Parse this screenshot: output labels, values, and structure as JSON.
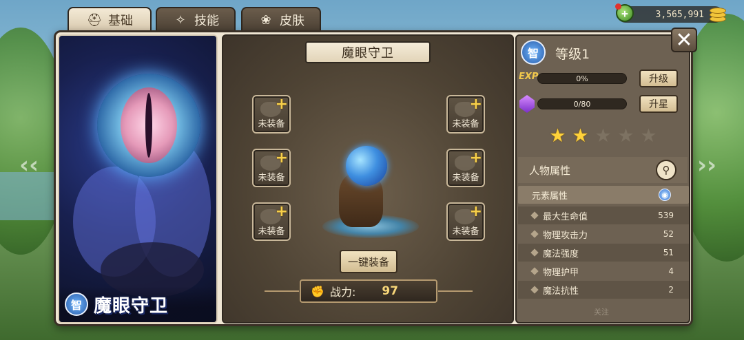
{
  "tabs": [
    {
      "label": "基础",
      "icon": "helmet-icon"
    },
    {
      "label": "技能",
      "icon": "skill-icon"
    },
    {
      "label": "皮肤",
      "icon": "skin-icon"
    }
  ],
  "currency": {
    "amount": "3,565,991"
  },
  "close_label": "✕",
  "portrait": {
    "type_badge": "智",
    "name": "魔眼守卫"
  },
  "hero": {
    "title": "魔眼守卫"
  },
  "slots": {
    "left": [
      "未装备",
      "未装备",
      "未装备"
    ],
    "right": [
      "未装备",
      "未装备",
      "未装备"
    ]
  },
  "equip_all_label": "一键装备",
  "power": {
    "label": "战力:",
    "value": "97"
  },
  "level": {
    "badge": "智",
    "text": "等级1"
  },
  "exp": {
    "label": "EXP",
    "value": "0%",
    "fill": 0
  },
  "upgrade_label": "升级",
  "shards": {
    "value": "0/80",
    "fill": 0
  },
  "star_up_label": "升星",
  "stars": {
    "filled": 2,
    "total": 5
  },
  "attributes": {
    "header": "人物属性",
    "element_label": "元素属性",
    "stats": [
      {
        "name": "最大生命值",
        "value": "539"
      },
      {
        "name": "物理攻击力",
        "value": "52"
      },
      {
        "name": "魔法强度",
        "value": "51"
      },
      {
        "name": "物理护甲",
        "value": "4"
      },
      {
        "name": "魔法抗性",
        "value": "2"
      }
    ]
  },
  "follow_label": "关注",
  "colors": {
    "accent_gold": "#f2c94c",
    "panel_brown": "#6d6152",
    "intelligence_blue": "#2a5ca8"
  }
}
